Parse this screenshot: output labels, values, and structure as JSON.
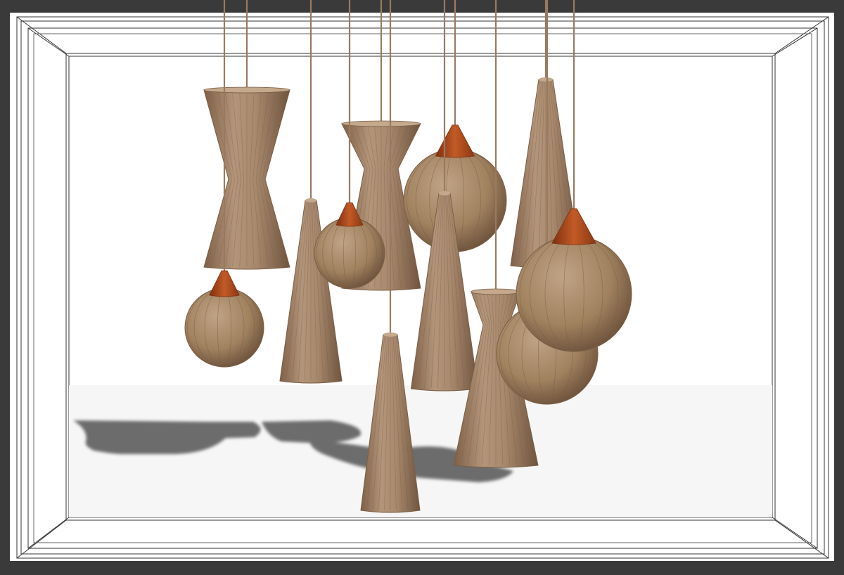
{
  "scene": {
    "frame_color": "#3a3a3a",
    "backdrop_color": "#ffffff",
    "wireframe_color": "#333333",
    "floor_tint": "#f4f4f4",
    "shadow_color": "#555555",
    "wicker_color": "#a8896d",
    "wicker_dark": "#7a5e46",
    "wicker_light": "#c4a98c",
    "cord_color": "#9a7a5e",
    "cap_color": "#b24c1c",
    "cap_dark": "#7e3010",
    "pendants": [
      {
        "shape": "hourglass-lamp"
      },
      {
        "shape": "globe-lamp"
      },
      {
        "shape": "cone-lamp"
      },
      {
        "shape": "globe-lamp"
      },
      {
        "shape": "hourglass-lamp"
      },
      {
        "shape": "globe-lamp"
      },
      {
        "shape": "cone-lamp"
      },
      {
        "shape": "cone-lamp"
      },
      {
        "shape": "cone-lamp"
      },
      {
        "shape": "hourglass-lamp"
      },
      {
        "shape": "globe-lamp"
      },
      {
        "shape": "globe-lamp"
      }
    ]
  }
}
